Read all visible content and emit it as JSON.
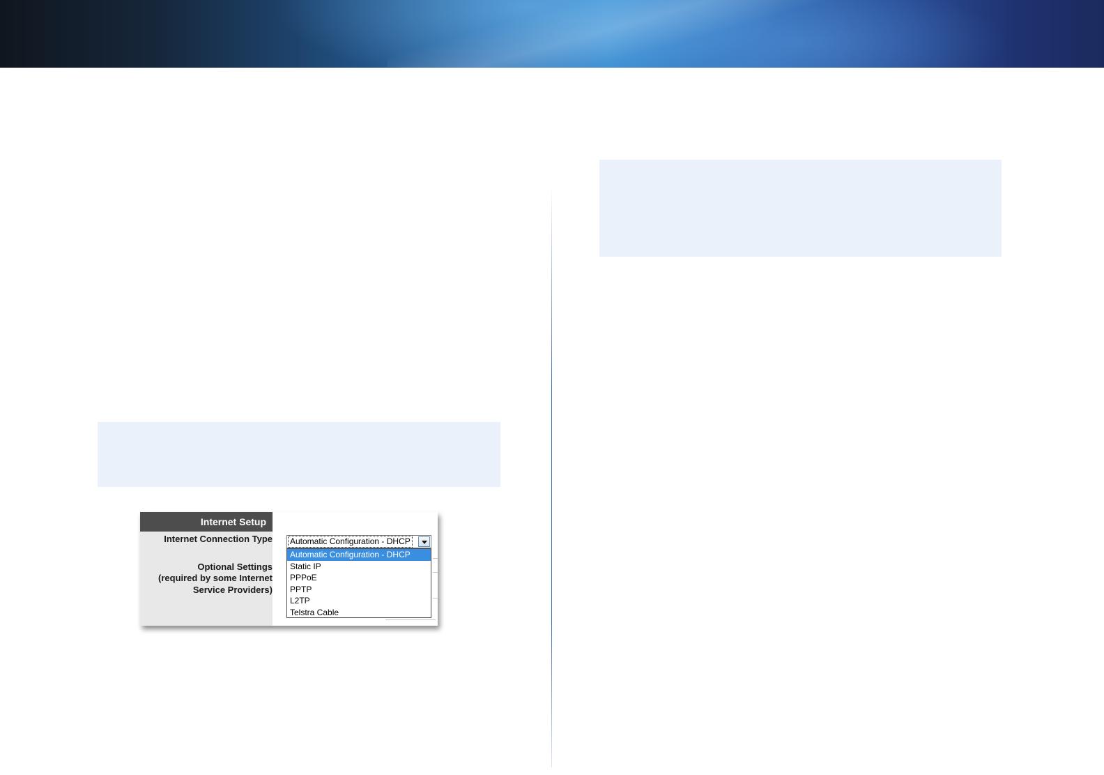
{
  "panel": {
    "title": "Internet Setup",
    "connection_type_label": "Internet Connection Type",
    "optional_settings_label": "Optional Settings",
    "optional_settings_note_line1": "(required by some Internet",
    "optional_settings_note_line2": "Service Providers)"
  },
  "connection_select": {
    "selected_value": "Automatic Configuration - DHCP",
    "options": [
      {
        "label": "Automatic Configuration - DHCP",
        "selected": true
      },
      {
        "label": "Static IP",
        "selected": false
      },
      {
        "label": "PPPoE",
        "selected": false
      },
      {
        "label": "PPTP",
        "selected": false
      },
      {
        "label": "L2TP",
        "selected": false
      },
      {
        "label": "Telstra Cable",
        "selected": false
      }
    ]
  },
  "colors": {
    "header_dark": "#10161f",
    "header_blue": "#3c8ed2",
    "note_background": "#eaf1fa",
    "panel_title_background": "#4d4d4d",
    "selected_option": "#3a8ee0"
  },
  "icons": {
    "dropdown_arrow": "chevron-down-icon"
  }
}
